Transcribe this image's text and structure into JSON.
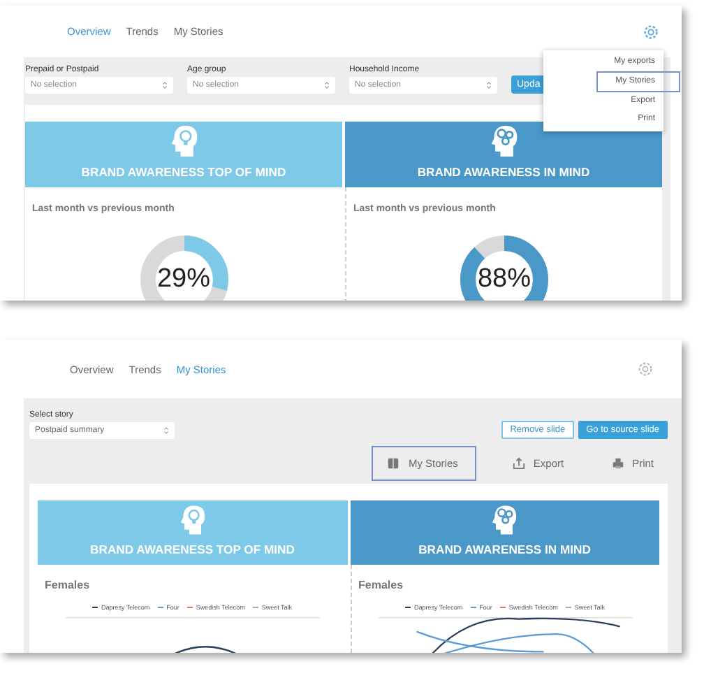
{
  "overview_screen": {
    "tabs": [
      {
        "label": "Overview",
        "selected": true
      },
      {
        "label": "Trends",
        "selected": false
      },
      {
        "label": "My Stories",
        "selected": false
      }
    ],
    "filters": [
      {
        "label": "Prepaid or Postpaid",
        "placeholder": "No selection"
      },
      {
        "label": "Age group",
        "placeholder": "No selection"
      },
      {
        "label": "Household Income",
        "placeholder": "No selection"
      }
    ],
    "update_button": "Upda",
    "menu": [
      {
        "label": "My exports",
        "highlighted": false
      },
      {
        "label": "My Stories",
        "highlighted": true
      },
      {
        "label": "Export",
        "highlighted": false
      },
      {
        "label": "Print",
        "highlighted": false
      }
    ],
    "cards": [
      {
        "title": "BRAND AWARENESS TOP OF MIND",
        "color": "#7ec8e8",
        "subtitle": "Last month vs previous month",
        "kind": "gauge",
        "value": "29%"
      },
      {
        "title": "BRAND AWARENESS IN MIND",
        "color": "#4a98c8",
        "subtitle": "Last month vs previous month",
        "kind": "gauge",
        "value": "88%"
      }
    ]
  },
  "stories_screen": {
    "tabs": [
      {
        "label": "Overview",
        "selected": false
      },
      {
        "label": "Trends",
        "selected": false
      },
      {
        "label": "My Stories",
        "selected": true
      }
    ],
    "story_select": {
      "label": "Select story",
      "value": "Postpaid summary"
    },
    "buttons": [
      {
        "label": "Remove slide",
        "kind": "outline"
      },
      {
        "label": "Go to source slide",
        "kind": "primary"
      }
    ],
    "toolbar": [
      {
        "label": "My Stories",
        "highlighted": true
      },
      {
        "label": "Export",
        "highlighted": false
      },
      {
        "label": "Print",
        "highlighted": false
      }
    ],
    "cards": [
      {
        "title": "BRAND AWARENESS TOP OF MIND",
        "color": "#7ec8e8",
        "subtitle": "Females",
        "kind": "lines",
        "legend": [
          {
            "label": "Dapresy Telecom",
            "color": "#2c3e5e"
          },
          {
            "label": "Four",
            "color": "#5b9bd5"
          },
          {
            "label": "Swedish Telecom",
            "color": "#e07a4f"
          },
          {
            "label": "Sweet Talk",
            "color": "#8fb4d8"
          }
        ]
      },
      {
        "title": "BRAND AWARENESS IN MIND",
        "color": "#4a98c8",
        "subtitle": "Females",
        "kind": "lines",
        "legend": [
          {
            "label": "Dapresy Telecom",
            "color": "#2c3e5e"
          },
          {
            "label": "Four",
            "color": "#5b9bd5"
          },
          {
            "label": "Swedish Telecom",
            "color": "#e07a4f"
          },
          {
            "label": "Sweet Talk",
            "color": "#8fb4d8"
          }
        ]
      }
    ]
  }
}
